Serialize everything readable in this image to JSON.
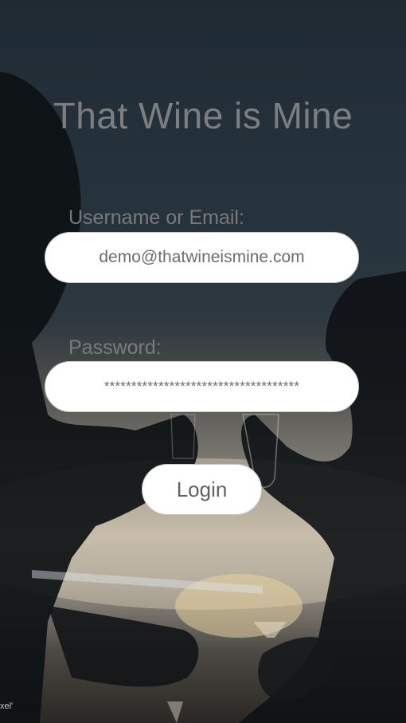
{
  "app": {
    "title": "That Wine is Mine"
  },
  "form": {
    "username_label": "Username or Email:",
    "username_value": "demo@thatwineismine.com",
    "password_label": "Password:",
    "password_value": "************************************",
    "login_label": "Login"
  },
  "background": {
    "watermark_text": "xel'"
  },
  "colors": {
    "title_text": "#8c8c8c",
    "field_background": "#ffffff",
    "field_text": "#6c6c6c"
  }
}
